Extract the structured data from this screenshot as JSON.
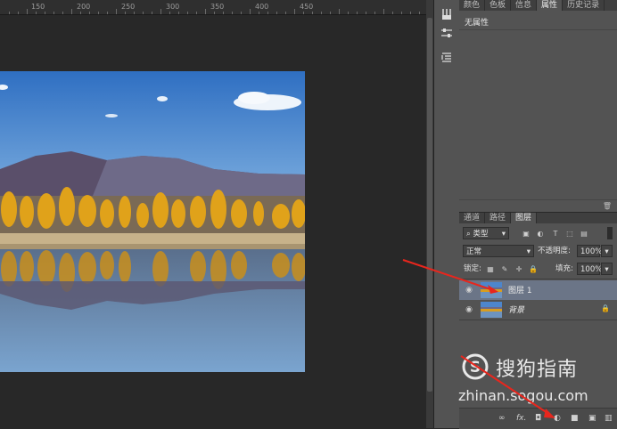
{
  "ruler": {
    "labels": [
      "150",
      "200",
      "250",
      "300",
      "350",
      "400",
      "450"
    ]
  },
  "tools": [
    "brush-tool-icon",
    "adjust-sliders-icon",
    "paragraph-icon"
  ],
  "props_panel": {
    "tabs": [
      "颜色",
      "色板",
      "信息",
      "属性",
      "历史记录"
    ],
    "active_tab": "属性",
    "title": "无属性"
  },
  "layers_panel": {
    "tabs": [
      "通道",
      "路径",
      "图层"
    ],
    "active_tab": "图层",
    "filter_label": "类型",
    "blend_mode": "正常",
    "opacity_label": "不透明度:",
    "opacity_value": "100%",
    "lock_label": "锁定:",
    "fill_label": "填充:",
    "fill_value": "100%",
    "layers": [
      {
        "name": "图层 1",
        "selected": true
      },
      {
        "name": "背景",
        "selected": false,
        "locked": true
      }
    ],
    "footer_icons": [
      "link-icon",
      "fx-icon",
      "mask-icon",
      "adjustment-icon",
      "folder-icon",
      "new-layer-icon",
      "trash-icon"
    ]
  },
  "watermark": {
    "brand": "搜狗指南",
    "domain": "zhinan.sogou.com"
  },
  "colors": {
    "panel": "#535353",
    "canvas": "#282828",
    "arrow": "#e8261d",
    "selected_row": "#6b7587"
  }
}
